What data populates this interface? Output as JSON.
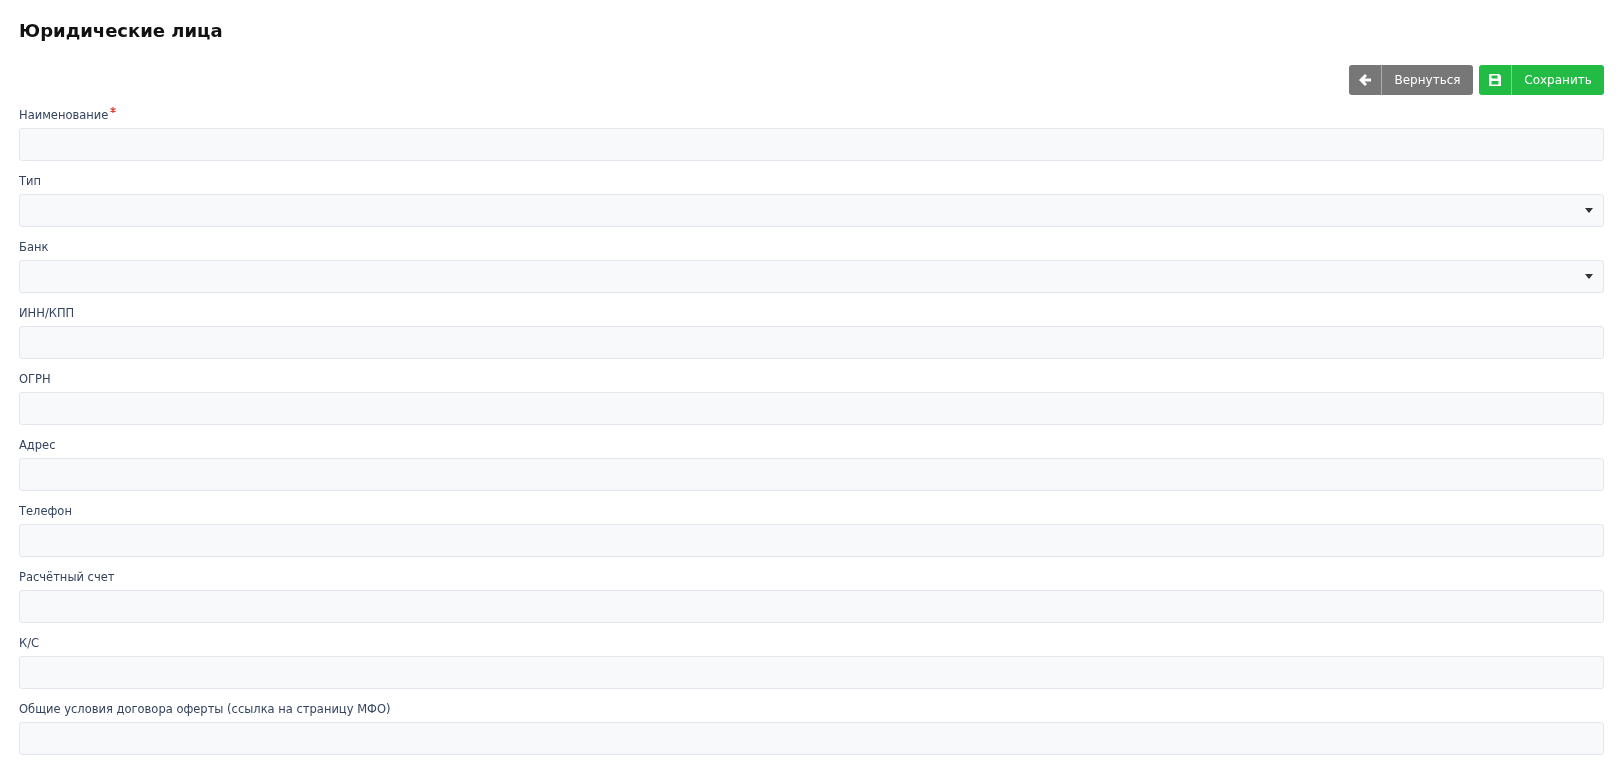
{
  "title": "Юридические лица",
  "buttons": [
    {
      "kind": "back",
      "label": "Вернуться"
    },
    {
      "kind": "save",
      "label": "Сохранить"
    }
  ],
  "fields": [
    {
      "label": "Наименование",
      "kind": "text",
      "required": true
    },
    {
      "label": "Тип",
      "kind": "select",
      "required": false
    },
    {
      "label": "Банк",
      "kind": "select",
      "required": false
    },
    {
      "label": "ИНН/КПП",
      "kind": "text",
      "required": false
    },
    {
      "label": "ОГРН",
      "kind": "text",
      "required": false
    },
    {
      "label": "Адрес",
      "kind": "text",
      "required": false
    },
    {
      "label": "Телефон",
      "kind": "text",
      "required": false
    },
    {
      "label": "Расчётный счет",
      "kind": "text",
      "required": false
    },
    {
      "label": "К/С",
      "kind": "text",
      "required": false
    },
    {
      "label": "Общие условия договора оферты (ссылка на страницу МФО)",
      "kind": "text",
      "required": false
    }
  ]
}
